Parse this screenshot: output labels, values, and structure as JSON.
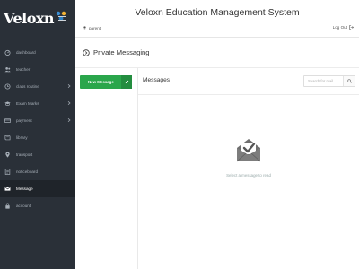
{
  "app": {
    "logo_text": "Veloxn",
    "title": "Veloxn Education Management System"
  },
  "header": {
    "user_name": "parent",
    "logout_label": "Log Out"
  },
  "sidebar": {
    "items": [
      {
        "label": "dashboard",
        "icon": "dashboard-icon",
        "has_submenu": false,
        "active": false
      },
      {
        "label": "teacher",
        "icon": "users-icon",
        "has_submenu": false,
        "active": false
      },
      {
        "label": "class routine",
        "icon": "clock-icon",
        "has_submenu": true,
        "active": false
      },
      {
        "label": "Exam Marks",
        "icon": "graduation-cap-icon",
        "has_submenu": true,
        "active": false
      },
      {
        "label": "payment",
        "icon": "credit-card-icon",
        "has_submenu": true,
        "active": false
      },
      {
        "label": "library",
        "icon": "book-icon",
        "has_submenu": false,
        "active": false
      },
      {
        "label": "transport",
        "icon": "location-icon",
        "has_submenu": false,
        "active": false
      },
      {
        "label": "noticeboard",
        "icon": "document-icon",
        "has_submenu": false,
        "active": false
      },
      {
        "label": "Message",
        "icon": "envelope-icon",
        "has_submenu": false,
        "active": true
      },
      {
        "label": "account",
        "icon": "lock-icon",
        "has_submenu": false,
        "active": false
      }
    ]
  },
  "page": {
    "title": "Private Messaging"
  },
  "messaging": {
    "new_message_label": "New Message",
    "messages_title": "Messages",
    "search_placeholder": "Search for mail...",
    "empty_text": "Select a message to read"
  },
  "colors": {
    "sidebar_bg": "#2a3038",
    "sidebar_active_bg": "#1f242a",
    "accent_green": "#2aa64b",
    "logo_accent": "#3b8fd6"
  }
}
